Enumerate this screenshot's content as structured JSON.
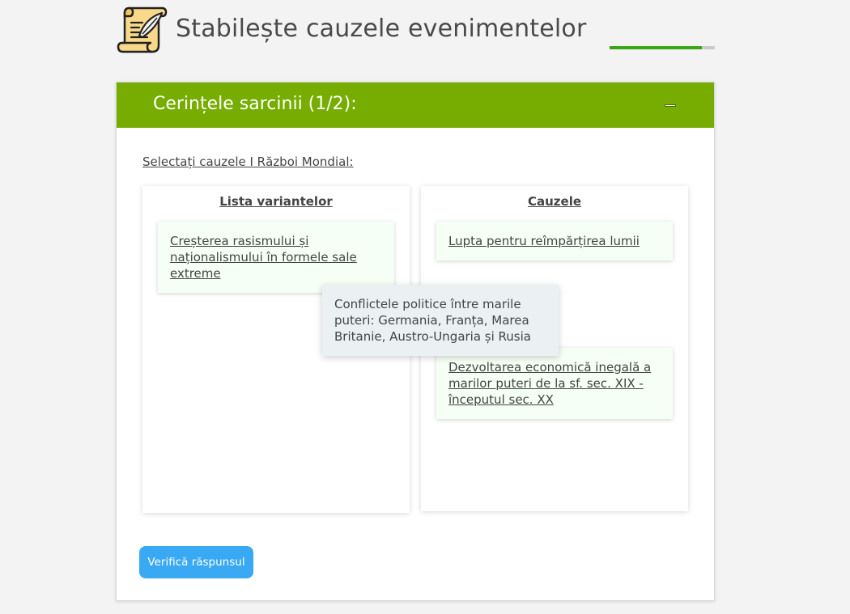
{
  "header": {
    "title": "Stabilește cauzele evenimentelor",
    "logo_icon": "scroll-quill-icon",
    "progress_fraction": 0.88
  },
  "task": {
    "header_title": "Cerințele sarcinii (1/2):",
    "prompt": "Selectați cauzele I Război Mondial:",
    "columns": {
      "options_title": "Lista variantelor",
      "causes_title": "Cauzele"
    },
    "options_items": [
      "Creșterea rasismului și naționalismului în formele sale extreme"
    ],
    "causes_items": [
      "Lupta pentru reîmpărțirea lumii",
      "Dezvoltarea economică inegală a marilor puteri de la sf. sec. XIX - începutul sec. XX"
    ],
    "dragging_item": "Conflictele politice între marile puteri: Germania, Franța, Marea Britanie, Austro-Ungaria și Rusia",
    "check_button_label": "Verifică răspunsul"
  },
  "colors": {
    "header_green": "#76ad00",
    "progress_green": "#3aa515",
    "button_blue": "#39a9f4",
    "item_bg": "#f6fff5",
    "drag_bg": "#ebf1f3"
  }
}
